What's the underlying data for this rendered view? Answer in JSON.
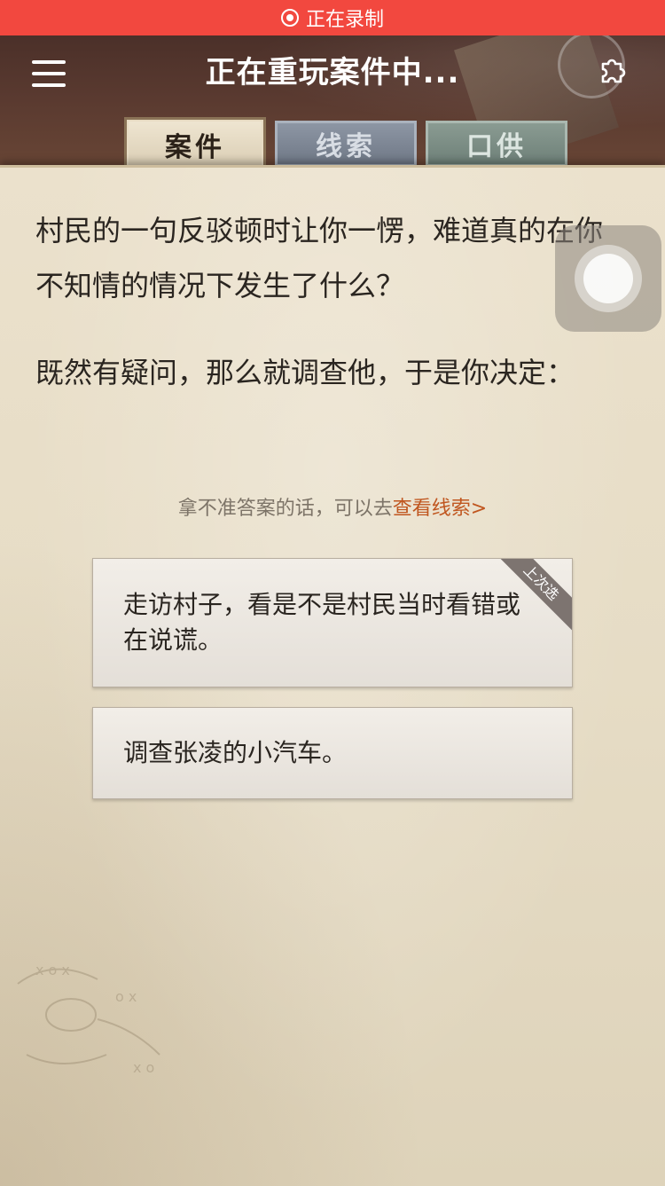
{
  "recording": {
    "label": "正在录制"
  },
  "header": {
    "title": "正在重玩案件中..."
  },
  "tabs": [
    {
      "label": "案件",
      "active": true
    },
    {
      "label": "线索",
      "active": false
    },
    {
      "label": "口供",
      "active": false
    }
  ],
  "story": {
    "paragraph_1": "村民的一句反驳顿时让你一愣，难道真的在你不知情的情况下发生了什么？",
    "paragraph_2": "既然有疑问，那么就调查他，于是你决定："
  },
  "hint": {
    "text": "拿不准答案的话，可以去",
    "link": "查看线索>"
  },
  "choices": [
    {
      "text": "走访村子，看是不是村民当时看错或在说谎。",
      "badge": "上次选"
    },
    {
      "text": "调查张凌的小汽车。"
    }
  ],
  "icons": {
    "menu": "menu-icon",
    "puzzle": "puzzle-icon",
    "record": "record-icon",
    "assistive": "assistive-touch-icon"
  },
  "colors": {
    "recording_bar": "#f2483f",
    "hint_link": "#c0561f",
    "paper": "#e6dcc5"
  }
}
